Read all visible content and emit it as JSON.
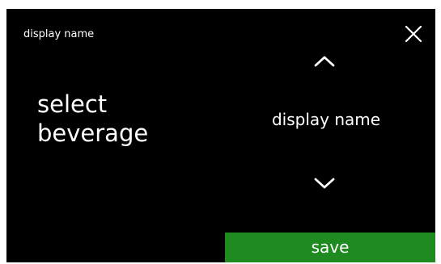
{
  "header": {
    "title": "display name",
    "close_icon": "close-icon"
  },
  "prompt": {
    "line1": "select",
    "line2": "beverage"
  },
  "selector": {
    "value": "display name",
    "up_icon": "chevron-up-icon",
    "down_icon": "chevron-down-icon"
  },
  "footer": {
    "save_label": "save"
  },
  "colors": {
    "background": "#000000",
    "text": "#ffffff",
    "save_button": "#1f8a1f"
  }
}
